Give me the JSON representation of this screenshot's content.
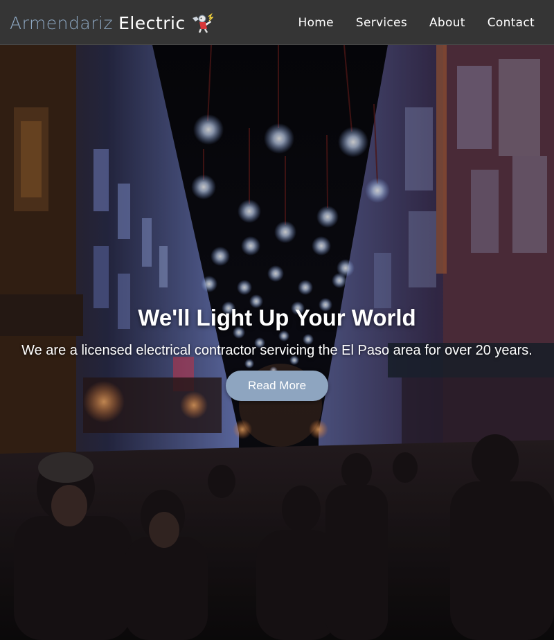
{
  "header": {
    "logo_text_1": "Armendariz",
    "logo_text_2": "Electric",
    "logo_icon": "electrician-mascot-icon",
    "nav": [
      {
        "label": "Home"
      },
      {
        "label": "Services"
      },
      {
        "label": "About"
      },
      {
        "label": "Contact"
      }
    ]
  },
  "hero": {
    "title": "We'll Light Up Your World",
    "subtitle": "We are a licensed electrical contractor servicing the El Paso area for over 20 years.",
    "button_label": "Read More",
    "background_description_icon": "street-lights-photo",
    "colors": {
      "button": "#8ea5c0",
      "header_bg": "#353535",
      "logo_accent": "#8fa9c4"
    }
  }
}
